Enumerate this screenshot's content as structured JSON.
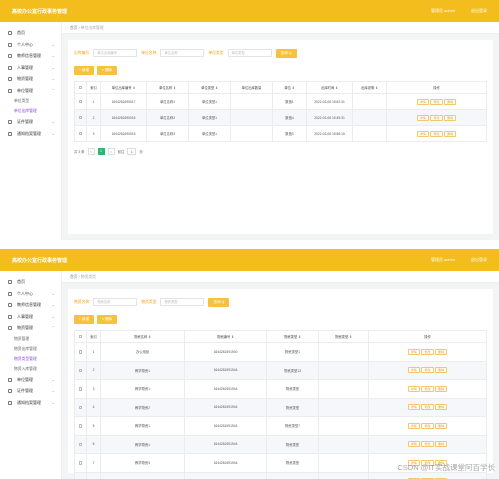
{
  "app": {
    "title": "高校办公室行政事务管理",
    "user": "管理员 admin",
    "logout": "退出登录"
  },
  "screen1": {
    "sidebar": {
      "items": [
        {
          "label": "首页",
          "icon": "home-icon",
          "chev": ""
        },
        {
          "label": "个人中心",
          "icon": "user-icon",
          "chev": "⌄"
        },
        {
          "label": "教师信息管理",
          "icon": "teacher-icon",
          "chev": "⌄"
        },
        {
          "label": "人事管理",
          "icon": "people-icon",
          "chev": "⌄"
        },
        {
          "label": "物资管理",
          "icon": "box-icon",
          "chev": "⌄"
        },
        {
          "label": "单位管理",
          "icon": "unit-icon",
          "chev": "⌃"
        }
      ],
      "subitems": [
        {
          "label": "单位类型",
          "active": false
        },
        {
          "label": "单位出库管理",
          "active": true
        }
      ],
      "items_after": [
        {
          "label": "证件管理",
          "icon": "card-icon",
          "chev": "⌄"
        },
        {
          "label": "通知档案管理",
          "icon": "doc-icon",
          "chev": "⌄"
        }
      ]
    },
    "breadcrumb": {
      "home": "首页",
      "sep": "/",
      "current": "单位出库管理"
    },
    "search": {
      "fields": [
        {
          "label": "出库编号",
          "placeholder": "单位出库编号"
        },
        {
          "label": "单位名称",
          "placeholder": "单位名称"
        },
        {
          "label": "单位类型",
          "placeholder": "单位类型"
        }
      ],
      "query_label": "查询 Q"
    },
    "actions": {
      "add": "+ 新增",
      "delete": "× 删除"
    },
    "table": {
      "headers": [
        "",
        "索引",
        "单位出库编号 ⇕",
        "单位名称 ⇕",
        "单位类型 ⇕",
        "单位出库数量",
        "单位 ⇕",
        "出库时间 ⇕",
        "出库说明 ⇕",
        "操作"
      ],
      "rows": [
        [
          "1",
          "1644262490017",
          "单位名称1",
          "单位类型1",
          "",
          "数值1",
          "2022-02-06 15:52:31",
          ""
        ],
        [
          "2",
          "1644262490016",
          "单位名称2",
          "单位类型1",
          "",
          "数值4",
          "2022-02-06 15:49:31",
          ""
        ],
        [
          "3",
          "1644262490015",
          "单位名称3",
          "单位类型1",
          "",
          "数值3",
          "2022-02-06 15:56:15",
          ""
        ]
      ],
      "ops": [
        "详情",
        "修改",
        "删除"
      ]
    },
    "pager": {
      "total": "共 3 条",
      "prev": "<",
      "current": "1",
      "next": ">",
      "goto": "前往",
      "page_no": "1",
      "page_unit": "页"
    }
  },
  "screen2": {
    "sidebar": {
      "items": [
        {
          "label": "首页",
          "icon": "home-icon",
          "chev": ""
        },
        {
          "label": "个人中心",
          "icon": "user-icon",
          "chev": "⌄"
        },
        {
          "label": "教师信息管理",
          "icon": "teacher-icon",
          "chev": "⌄"
        },
        {
          "label": "人事管理",
          "icon": "people-icon",
          "chev": "⌄"
        },
        {
          "label": "物资管理",
          "icon": "box-icon",
          "chev": "⌃"
        }
      ],
      "subitems": [
        {
          "label": "物资管理",
          "active": false
        },
        {
          "label": "物资出库管理",
          "active": false
        },
        {
          "label": "物资类型管理",
          "active": true
        },
        {
          "label": "物资入库管理",
          "active": false
        }
      ],
      "items_after": [
        {
          "label": "单位管理",
          "icon": "unit-icon",
          "chev": "⌄"
        },
        {
          "label": "证件管理",
          "icon": "card-icon",
          "chev": "⌄"
        },
        {
          "label": "通知档案管理",
          "icon": "doc-icon",
          "chev": "⌄"
        }
      ]
    },
    "breadcrumb": {
      "home": "首页",
      "sep": "/",
      "current": "物资类型"
    },
    "search": {
      "fields": [
        {
          "label": "物资名称",
          "placeholder": "物资名称"
        },
        {
          "label": "物资类型",
          "placeholder": "物资类型"
        }
      ],
      "query_label": "查询 Q"
    },
    "actions": {
      "add": "+ 新增",
      "delete": "× 删除"
    },
    "table": {
      "headers": [
        "",
        "索引",
        "物资名称 ⇕",
        "物资编号 ⇕",
        "物资类型 ⇕",
        "物资类型 ⇕",
        "操作"
      ],
      "rows": [
        [
          "1",
          "办公用品",
          "1644262491940",
          "物资类型1",
          ""
        ],
        [
          "2",
          "教学物资1",
          "1644262491944",
          "物资类型13",
          ""
        ],
        [
          "3",
          "教学物资1",
          "1644262491944",
          "物资类型",
          ""
        ],
        [
          "4",
          "教学物资2",
          "1644262491944",
          "物资类型",
          ""
        ],
        [
          "5",
          "教学物资1",
          "1644262491944",
          "物资类型7",
          ""
        ],
        [
          "6",
          "教学物资1",
          "1644262491944",
          "物资类型",
          ""
        ],
        [
          "7",
          "教学物资3",
          "1644262491944",
          "物资类型",
          ""
        ],
        [
          "8",
          "教学物资4",
          "1644262491944",
          "物资类型",
          ""
        ]
      ],
      "ops": [
        "详情",
        "修改",
        "删除"
      ]
    }
  },
  "watermark": "CSDN @IT实战课堂阿百学长",
  "colors": {
    "topbar": "#f2bd1d",
    "accent": "#f7c23b",
    "label": "#f2a31d",
    "sub_active": "#8a4cd9",
    "page_current": "#2db572"
  }
}
